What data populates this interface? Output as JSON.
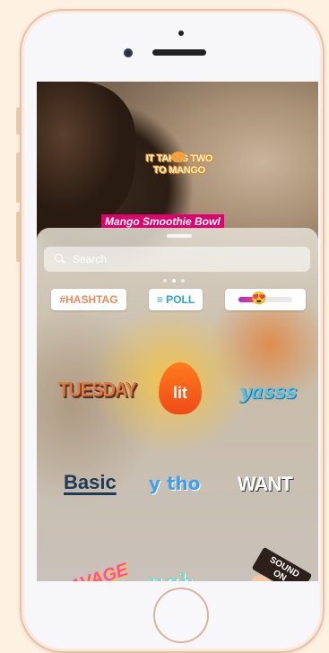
{
  "story": {
    "sticker_mango_line1": "IT TAKES TWO",
    "sticker_mango_line2": "TO MANGO",
    "caption": "Mango Smoothie Bowl"
  },
  "tray": {
    "search_placeholder": "Search",
    "page_indicator": {
      "count": 3,
      "active": 2
    },
    "top_stickers": {
      "hashtag": "#HASHTAG",
      "poll": "≡ POLL",
      "slider_emoji": "😍",
      "slider_level": 0.35
    },
    "stickers": {
      "tuesday": "TUESDAY",
      "lit": "lit",
      "yasss": "yasss",
      "basic": "Basic",
      "ytho": "y tho",
      "want": "WANT",
      "savage": "SAVAGE",
      "ugh": "ugh",
      "sound_on": "SOUND ON"
    }
  },
  "colors": {
    "phone_border": "#e6c2a8",
    "caption_bg": "#e0006b",
    "background": "#fdf1e2"
  },
  "icons": [
    "search-icon",
    "home-button",
    "front-camera",
    "earpiece-speaker"
  ]
}
